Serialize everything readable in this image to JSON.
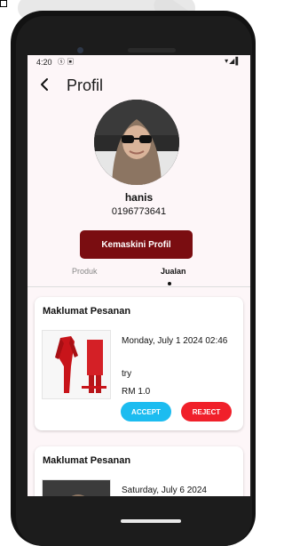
{
  "status_bar": {
    "time": "4:20",
    "left_icons": "ⓢ ▣",
    "right_icons": "▾◢▌"
  },
  "app_bar": {
    "back_icon": "←",
    "title": "Profil"
  },
  "profile": {
    "name": "hanis",
    "phone": "0196773641",
    "edit_button_label": "Kemaskini Profil"
  },
  "tabs": [
    {
      "label": "Produk",
      "selected": false
    },
    {
      "label": "Jualan",
      "selected": true
    }
  ],
  "orders": [
    {
      "title": "Maklumat Pesanan",
      "date": "Monday, July 1 2024 02:46",
      "note": "try",
      "price": "RM 1.0",
      "accept_label": "ACCEPT",
      "reject_label": "REJECT"
    },
    {
      "title": "Maklumat Pesanan",
      "date": "Saturday, July 6 2024"
    }
  ],
  "colors": {
    "primary": "#7a0d11",
    "accept": "#1cbcf0",
    "reject": "#f0202a",
    "screen_bg": "#fdf6f8"
  }
}
